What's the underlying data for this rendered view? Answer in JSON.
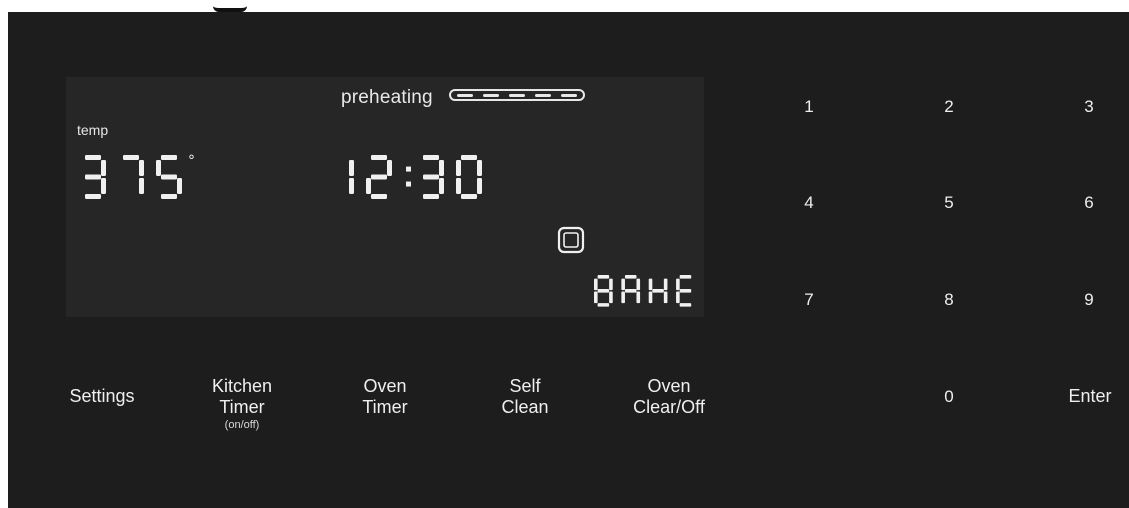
{
  "display": {
    "preheat_label": "preheating",
    "preheat_progress": 1.0,
    "temp_label": "temp",
    "temperature": "375",
    "degree_symbol": "°",
    "time": "12:30",
    "mode": "BAKE",
    "oven_icon": "oven-icon"
  },
  "keypad": {
    "keys": [
      "1",
      "2",
      "3",
      "4",
      "5",
      "6",
      "7",
      "8",
      "9",
      "0"
    ],
    "enter_label": "Enter"
  },
  "function_buttons": {
    "settings": "Settings",
    "kitchen_timer_line1": "Kitchen",
    "kitchen_timer_line2": "Timer",
    "kitchen_timer_sub": "(on/off)",
    "oven_timer_line1": "Oven",
    "oven_timer_line2": "Timer",
    "self_clean_line1": "Self",
    "self_clean_line2": "Clean",
    "oven_clear_line1": "Oven",
    "oven_clear_line2": "Clear/Off"
  },
  "colors": {
    "background": "#1d1d1d",
    "display_background": "#262626",
    "segment": "#f0f0f0",
    "text": "#efefef"
  }
}
